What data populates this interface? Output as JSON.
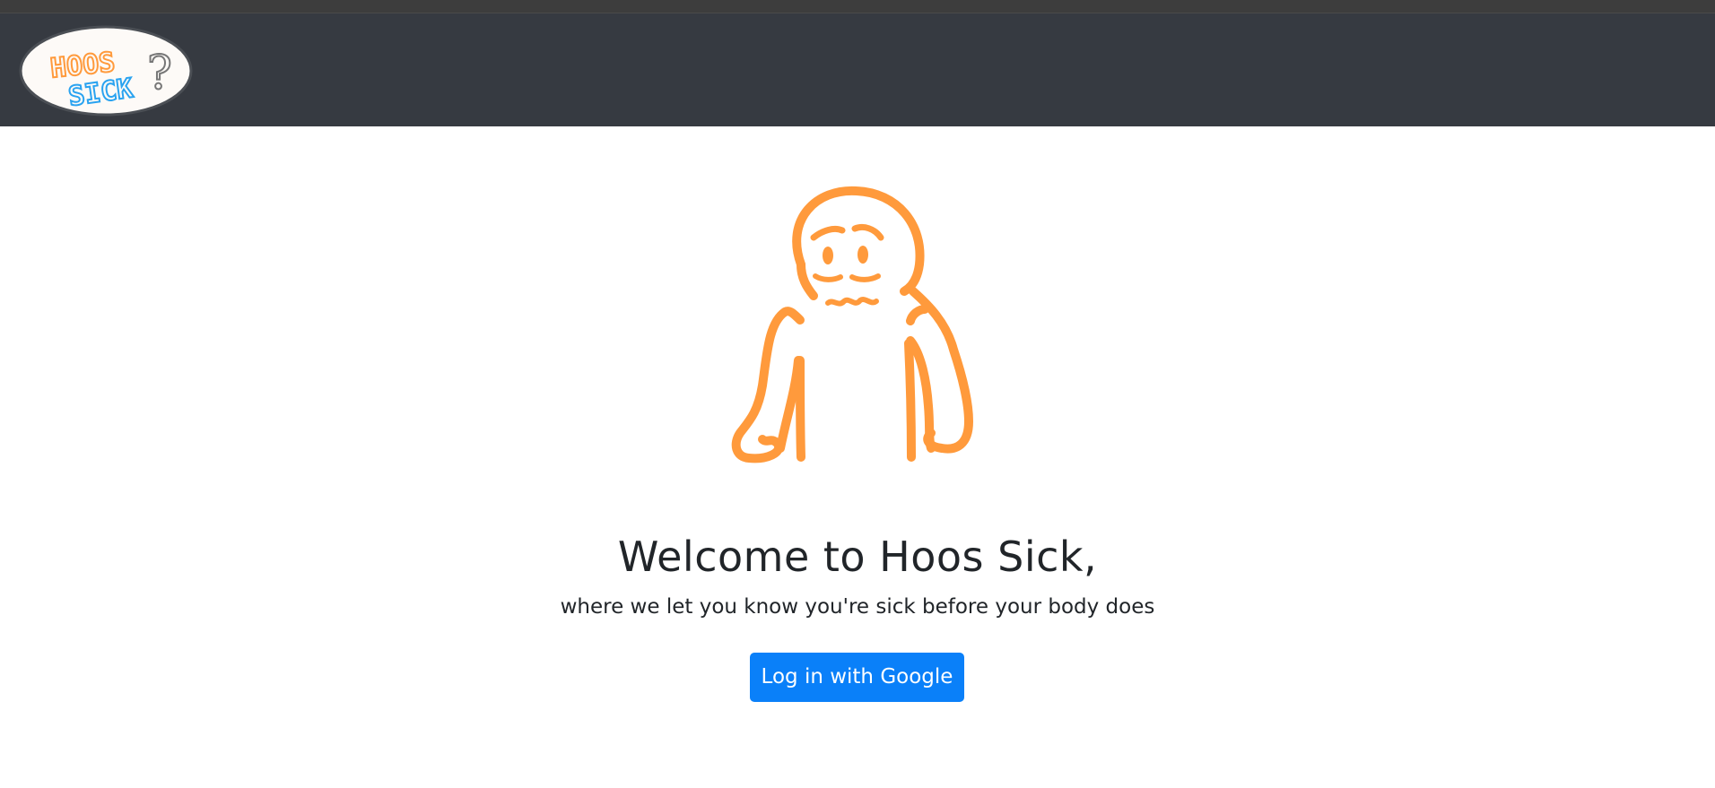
{
  "header": {
    "logo_line1": "HOOS",
    "logo_line2": "SICK",
    "logo_mark": "?"
  },
  "hero": {
    "illustration": "worried-person-illustration",
    "accent_color": "#ff9a3c"
  },
  "main": {
    "title": "Welcome to Hoos Sick,",
    "subtitle": "where we let you know you're sick before your body does",
    "login_button_label": "Log in with Google",
    "login_button_color": "#0a80f9"
  }
}
